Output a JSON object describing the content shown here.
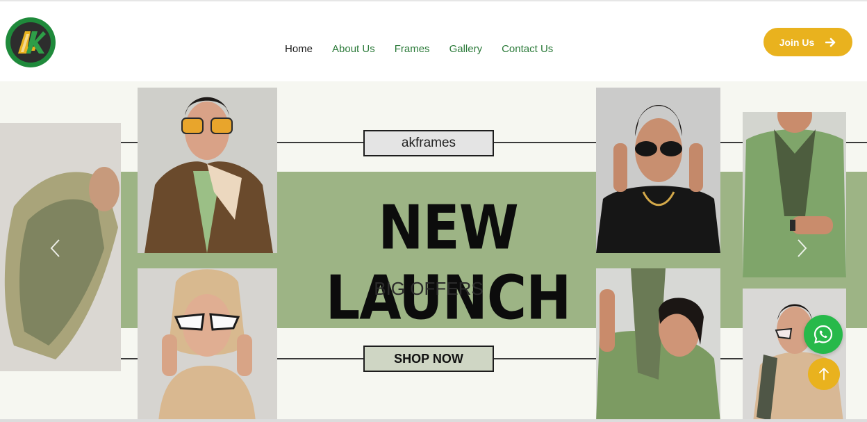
{
  "header": {
    "nav": [
      {
        "label": "Home"
      },
      {
        "label": "About Us"
      },
      {
        "label": "Frames"
      },
      {
        "label": "Gallery"
      },
      {
        "label": "Contact Us"
      }
    ],
    "join_label": "Join Us"
  },
  "hero": {
    "brand_label": "akframes",
    "headline": "NEW LAUNCH",
    "subheadline": "BIG OFFERS",
    "cta_label": "SHOP NOW"
  },
  "colors": {
    "brand_green": "#2b7a39",
    "accent_yellow": "#e9b21e",
    "band_green": "#9db485",
    "whatsapp_green": "#27b94a"
  },
  "icons": {
    "logo": "ak-logo",
    "join_arrow": "arrow-right-icon",
    "prev": "chevron-left-icon",
    "next": "chevron-right-icon",
    "whatsapp": "whatsapp-icon",
    "scroll_top": "arrow-up-icon"
  }
}
